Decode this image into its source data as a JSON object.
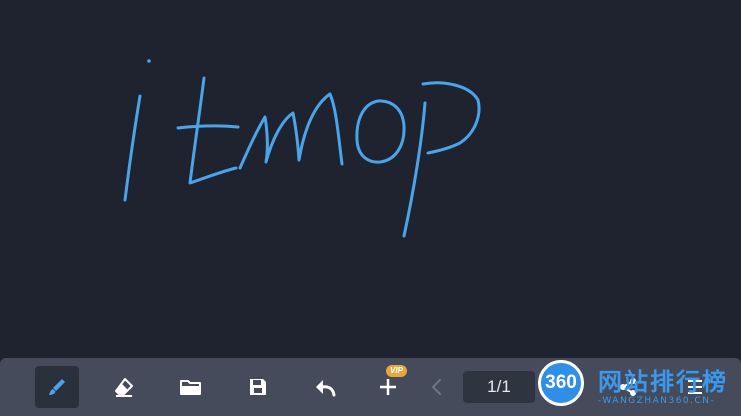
{
  "canvas": {
    "background": "#1f2330",
    "ink_color": "#4ba4e8",
    "handwriting_text": "itmop"
  },
  "toolbar": {
    "background": "#454b5a",
    "tools": [
      {
        "name": "brush",
        "icon": "brush-icon",
        "active": true
      },
      {
        "name": "eraser",
        "icon": "eraser-icon"
      },
      {
        "name": "open",
        "icon": "folder-icon"
      },
      {
        "name": "save",
        "icon": "save-icon"
      },
      {
        "name": "undo",
        "icon": "undo-icon"
      },
      {
        "name": "add-page",
        "icon": "plus-icon"
      },
      {
        "name": "previous-page",
        "icon": "chevron-left-icon"
      },
      {
        "name": "share",
        "icon": "share-icon"
      },
      {
        "name": "menu",
        "icon": "menu-icon"
      }
    ],
    "vip_badge": "VIP",
    "page_indicator": "1/1"
  },
  "watermark": {
    "logo_text": "360",
    "title": "网站排行榜",
    "subtitle": "-WANGZHAN360.CN-"
  }
}
